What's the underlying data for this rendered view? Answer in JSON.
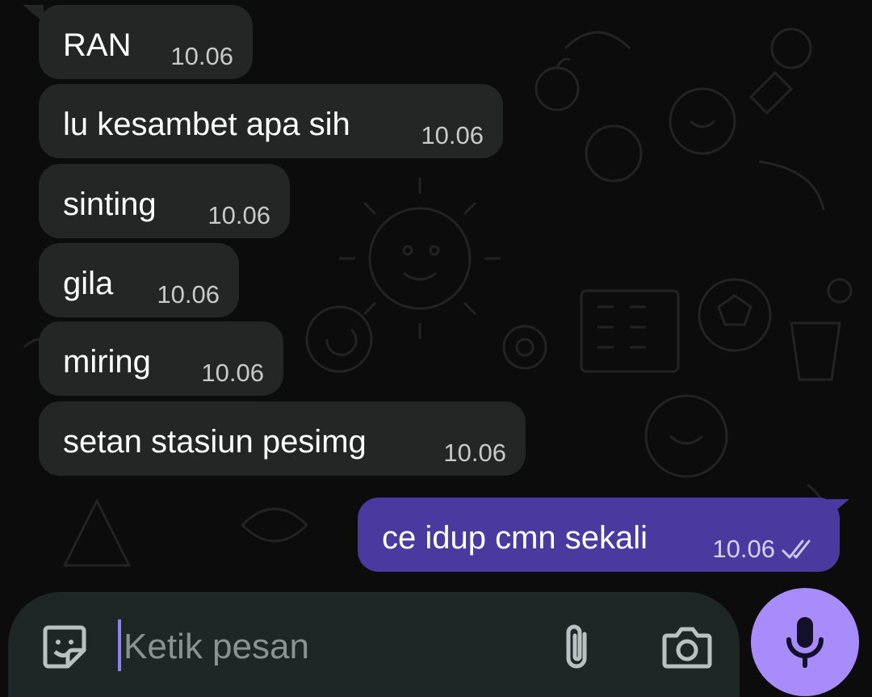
{
  "messages": [
    {
      "direction": "in",
      "text": "RAN",
      "time": "10.06"
    },
    {
      "direction": "in",
      "text": "lu kesambet apa sih",
      "time": "10.06"
    },
    {
      "direction": "in",
      "text": "sinting",
      "time": "10.06"
    },
    {
      "direction": "in",
      "text": "gila",
      "time": "10.06"
    },
    {
      "direction": "in",
      "text": "miring",
      "time": "10.06"
    },
    {
      "direction": "in",
      "text": "setan stasiun pesimg",
      "time": "10.06"
    },
    {
      "direction": "out",
      "text": "ce idup cmn sekali",
      "time": "10.06",
      "status": "read"
    }
  ],
  "input": {
    "placeholder": "Ketik pesan"
  },
  "icons": {
    "sticker": "sticker-icon",
    "attach": "paperclip-icon",
    "camera": "camera-icon",
    "mic": "microphone-icon",
    "read_receipt": "double-check-icon"
  },
  "colors": {
    "background": "#0c0c0c",
    "incoming_bubble": "#242626",
    "outgoing_bubble": "#4a3aa0",
    "input_bar": "#1f2626",
    "mic_button": "#a88cfb",
    "caret": "#8f82f0"
  }
}
